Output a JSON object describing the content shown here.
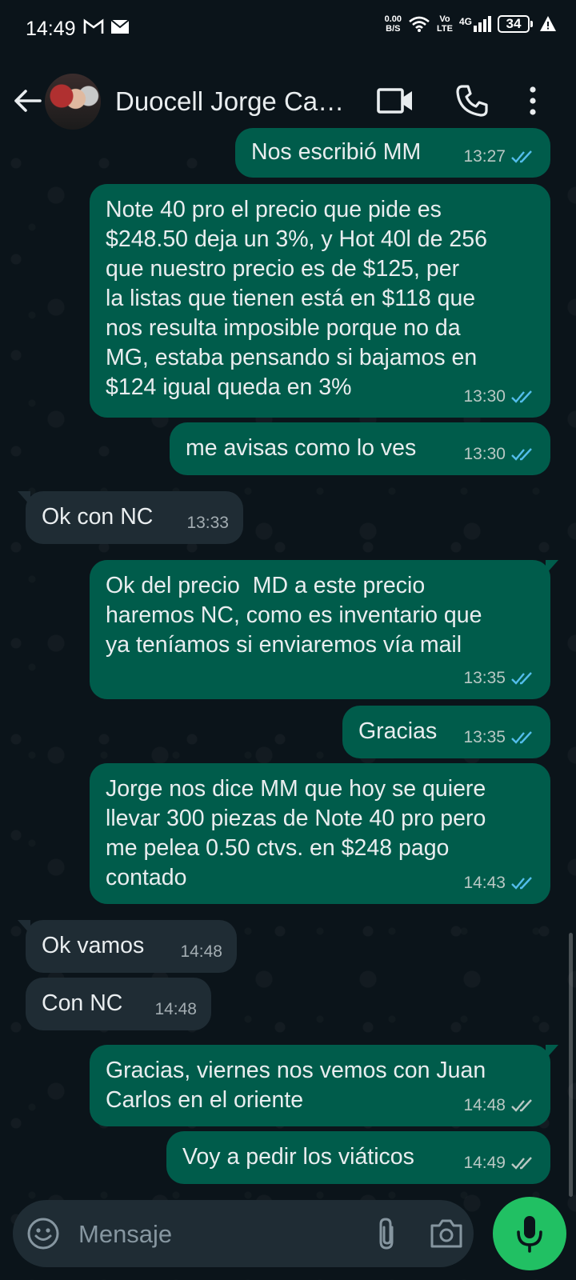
{
  "status_bar": {
    "time": "14:49",
    "net_speed_value": "0.00",
    "net_speed_unit": "B/S",
    "volte_top": "Vo",
    "volte_bottom": "LTE",
    "network": "4G",
    "battery": "34"
  },
  "header": {
    "contact_name": "Duocell Jorge Ca…"
  },
  "messages": [
    {
      "direction": "out",
      "text": "Nos escribió MM",
      "time": "13:27",
      "status": "read"
    },
    {
      "direction": "out",
      "text": "Note 40 pro el precio que pide es\n$248.50 deja un 3%, y Hot 40l de 256\nque nuestro precio es de $125, per\nla listas que tienen está en $118 que\nnos resulta imposible porque no da\nMG, estaba pensando si bajamos en\n$124 igual queda en 3%",
      "time": "13:30",
      "status": "read"
    },
    {
      "direction": "out",
      "text": "me avisas como lo ves",
      "time": "13:30",
      "status": "read"
    },
    {
      "direction": "in",
      "text": "Ok con NC",
      "time": "13:33"
    },
    {
      "direction": "out",
      "text": "Ok del precio  MD a este precio\nharemos NC, como es inventario que\nya teníamos si enviaremos vía mail",
      "time": "13:35",
      "status": "read"
    },
    {
      "direction": "out",
      "text": "Gracias",
      "time": "13:35",
      "status": "read"
    },
    {
      "direction": "out",
      "text": "Jorge nos dice MM que hoy se quiere\nllevar 300 piezas de Note 40 pro pero\nme pelea 0.50 ctvs. en $248 pago\ncontado",
      "time": "14:43",
      "status": "read"
    },
    {
      "direction": "in",
      "text": "Ok vamos",
      "time": "14:48"
    },
    {
      "direction": "in",
      "text": "Con NC",
      "time": "14:48"
    },
    {
      "direction": "out",
      "text": "Gracias, viernes nos vemos con Juan\nCarlos en el oriente",
      "time": "14:48",
      "status": "delivered"
    },
    {
      "direction": "out",
      "text": "Voy a pedir los viáticos",
      "time": "14:49",
      "status": "delivered"
    }
  ],
  "composer": {
    "placeholder": "Mensaje"
  },
  "colors": {
    "background": "#0b141a",
    "outgoing_bubble": "#005c4b",
    "incoming_bubble": "#1f2c34",
    "read_ticks": "#53bdeb",
    "delivered_ticks": "#b9c8c4",
    "mic_button": "#21c063"
  },
  "icons": {
    "gmail": "gmail-icon",
    "mail": "mail-icon",
    "wifi": "wifi-icon",
    "signal": "signal-icon",
    "alert": "alert-icon",
    "back": "back-arrow-icon",
    "video": "video-call-icon",
    "call": "phone-icon",
    "menu": "more-vert-icon",
    "emoji": "emoji-icon",
    "attach": "paperclip-icon",
    "camera": "camera-icon",
    "mic": "mic-icon"
  }
}
